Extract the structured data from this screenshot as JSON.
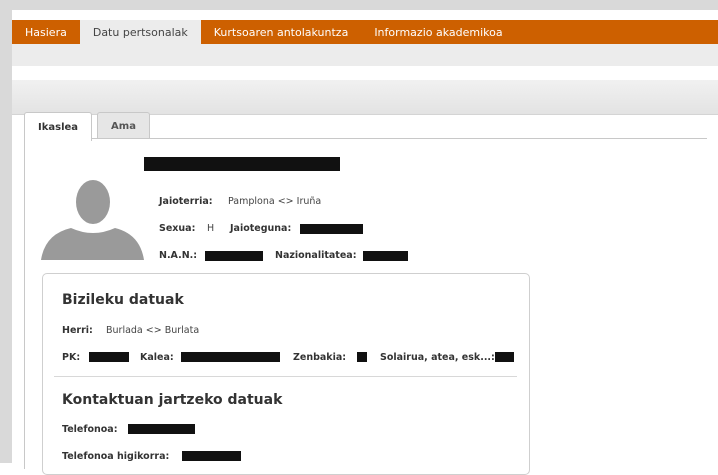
{
  "top_nav": {
    "tabs": [
      {
        "label": "Hasiera",
        "active": false
      },
      {
        "label": "Datu pertsonalak",
        "active": true
      },
      {
        "label": "Kurtsoaren antolakuntza",
        "active": false
      },
      {
        "label": "Informazio akademikoa",
        "active": false
      }
    ]
  },
  "inner_tabs": [
    {
      "label": "Ikaslea",
      "active": true
    },
    {
      "label": "Ama",
      "active": false
    }
  ],
  "profile": {
    "jaioterria_label": "Jaioterria:",
    "jaioterria_value": "Pamplona <> Iruña",
    "sexua_label": "Sexua:",
    "sexua_value": "H",
    "jaioteguna_label": "Jaioteguna:",
    "nan_label": "N.A.N.:",
    "nazionalitatea_label": "Nazionalitatea:"
  },
  "address": {
    "title": "Bizileku datuak",
    "herri_label": "Herri:",
    "herri_value": "Burlada <> Burlata",
    "pk_label": "PK:",
    "kalea_label": "Kalea:",
    "zenbakia_label": "Zenbakia:",
    "solairua_label": "Solairua, atea, esk...:"
  },
  "contact": {
    "title": "Kontaktuan jartzeko datuak",
    "telefonoa_label": "Telefonoa:",
    "mugikorra_label": "Telefonoa higikorra:"
  },
  "colors": {
    "nav_orange": "#cd6000",
    "redaction": "#111111"
  }
}
